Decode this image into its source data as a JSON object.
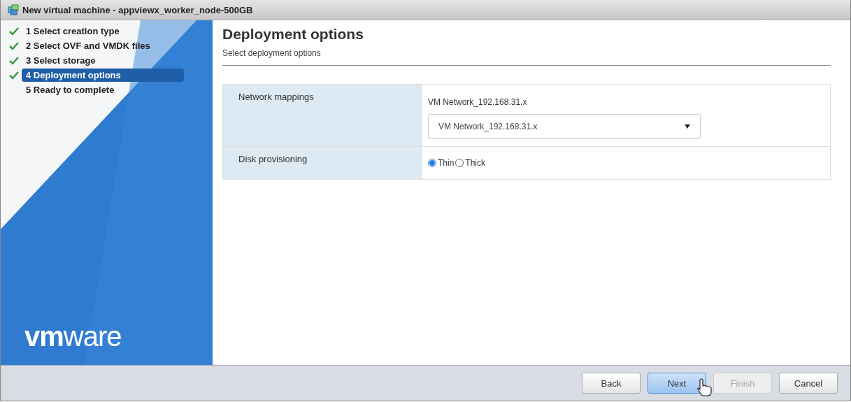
{
  "window": {
    "title": "New virtual machine - appviewx_worker_node-500GB"
  },
  "steps": [
    {
      "label": "1 Select creation type",
      "done": true,
      "selected": false
    },
    {
      "label": "2 Select OVF and VMDK files",
      "done": true,
      "selected": false
    },
    {
      "label": "3 Select storage",
      "done": true,
      "selected": false
    },
    {
      "label": "4 Deployment options",
      "done": true,
      "selected": true
    },
    {
      "label": "5 Ready to complete",
      "done": false,
      "selected": false
    }
  ],
  "logo": "**vm**ware",
  "page": {
    "title": "Deployment options",
    "subtitle": "Select deployment options"
  },
  "settings": [
    {
      "kind": "select",
      "label": "Network mappings",
      "source": "VM Network_192.168.31.x",
      "value": "VM Network_192.168.31.x"
    },
    {
      "kind": "radio",
      "label": "Disk provisioning",
      "options": [
        {
          "label": "Thin",
          "selected": true
        },
        {
          "label": "Thick",
          "selected": false
        }
      ]
    }
  ],
  "buttons": [
    {
      "label": "Back",
      "kind": "normal",
      "disabled": false
    },
    {
      "label": "Next",
      "kind": "primary",
      "disabled": false
    },
    {
      "label": "Finish",
      "kind": "normal",
      "disabled": true
    },
    {
      "label": "Cancel",
      "kind": "normal",
      "disabled": false
    }
  ]
}
